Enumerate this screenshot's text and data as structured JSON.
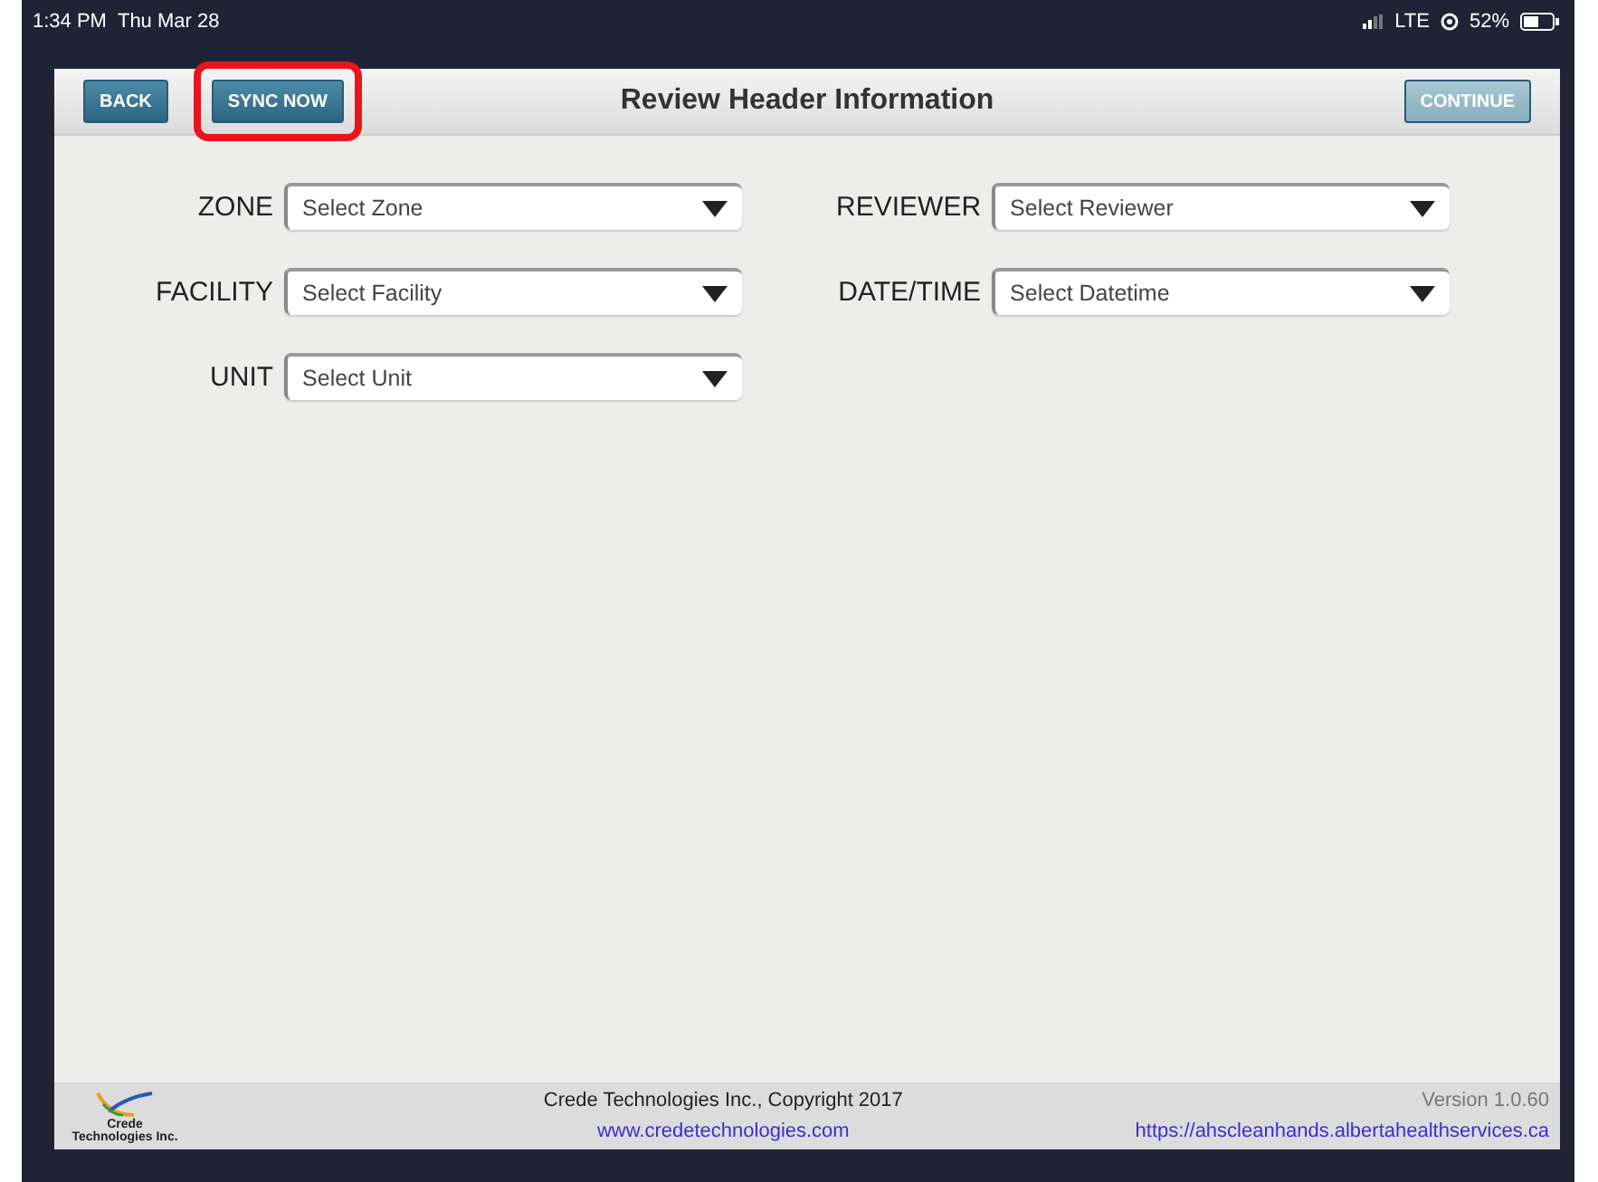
{
  "status_bar": {
    "time": "1:34 PM",
    "date": "Thu Mar 28",
    "carrier": "LTE",
    "battery": "52%"
  },
  "toolbar": {
    "title": "Review Header Information",
    "left_buttons": [
      {
        "label": "BACK",
        "highlighted": false,
        "disabled": false
      },
      {
        "label": "SYNC NOW",
        "highlighted": true,
        "disabled": false
      }
    ],
    "right_buttons": [
      {
        "label": "CONTINUE",
        "highlighted": false,
        "disabled": true
      }
    ]
  },
  "form": {
    "columns": [
      [
        {
          "label": "ZONE",
          "placeholder": "Select Zone"
        },
        {
          "label": "FACILITY",
          "placeholder": "Select Facility"
        },
        {
          "label": "UNIT",
          "placeholder": "Select Unit"
        }
      ],
      [
        {
          "label": "REVIEWER",
          "placeholder": "Select Reviewer"
        },
        {
          "label": "DATE/TIME",
          "placeholder": "Select Datetime"
        }
      ]
    ]
  },
  "footer": {
    "logo_text": [
      "Crede",
      "Technologies Inc."
    ],
    "copyright": "Crede Technologies Inc., Copyright 2017",
    "website": "www.credetechnologies.com",
    "version": "Version 1.0.60",
    "link": "https://ahscleanhands.albertahealthservices.ca"
  }
}
